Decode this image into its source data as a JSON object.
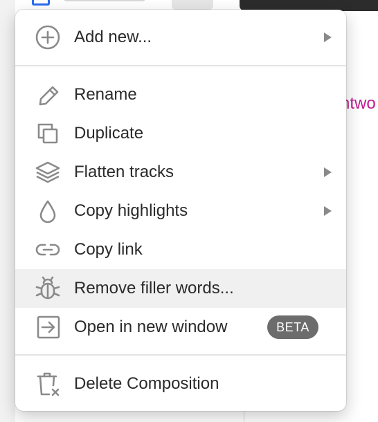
{
  "menu": {
    "items": [
      {
        "id": "add-new",
        "label": "Add new...",
        "icon": "plus-circle-icon",
        "submenu": true
      },
      {
        "id": "rename",
        "label": "Rename",
        "icon": "pencil-icon",
        "submenu": false
      },
      {
        "id": "duplicate",
        "label": "Duplicate",
        "icon": "duplicate-icon",
        "submenu": false
      },
      {
        "id": "flatten-tracks",
        "label": "Flatten tracks",
        "icon": "layers-icon",
        "submenu": true
      },
      {
        "id": "copy-highlights",
        "label": "Copy highlights",
        "icon": "droplet-icon",
        "submenu": true
      },
      {
        "id": "copy-link",
        "label": "Copy link",
        "icon": "link-icon",
        "submenu": false
      },
      {
        "id": "remove-filler-words",
        "label": "Remove filler words...",
        "icon": "bug-icon",
        "submenu": false,
        "highlighted": true
      },
      {
        "id": "open-in-new-window",
        "label": "Open in new window",
        "icon": "open-window-icon",
        "submenu": false,
        "badge": "BETA"
      },
      {
        "id": "delete-composition",
        "label": "Delete Composition",
        "icon": "trash-icon",
        "submenu": false
      }
    ]
  },
  "background": {
    "partial_text": "ntwo"
  },
  "colors": {
    "icon": "#8a8a8a",
    "text": "#2a2a2a",
    "highlight": "#f0f0f0",
    "badge": "#6c6c6c",
    "accent_text": "#c21b8f"
  }
}
